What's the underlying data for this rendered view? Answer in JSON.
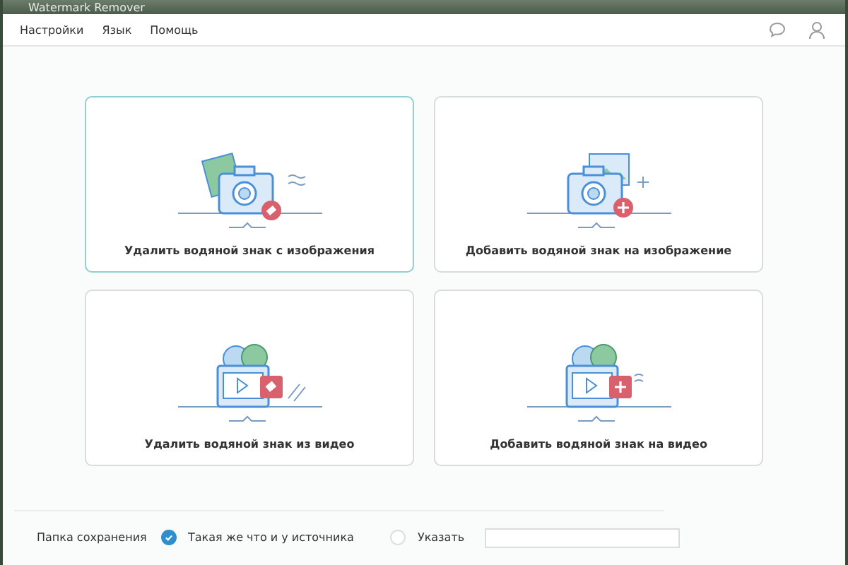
{
  "window": {
    "title": "Watermark Remover"
  },
  "menu": [
    {
      "label": "Настройки"
    },
    {
      "label": "Язык"
    },
    {
      "label": "Помощь"
    }
  ],
  "cards": [
    {
      "kind": "remove-image",
      "label": "Удалить водяной знак с изображения",
      "selected": true
    },
    {
      "kind": "add-image",
      "label": "Добавить водяной знак на изображение",
      "selected": false
    },
    {
      "kind": "remove-video",
      "label": "Удалить водяной знак из видео",
      "selected": false
    },
    {
      "kind": "add-video",
      "label": "Добавить водяной знак на видео",
      "selected": false
    }
  ],
  "save_folder": {
    "label": "Папка сохранения",
    "options": [
      {
        "label": "Такая же что и у источника",
        "selected": true
      },
      {
        "label": "Указать",
        "selected": false
      }
    ]
  }
}
